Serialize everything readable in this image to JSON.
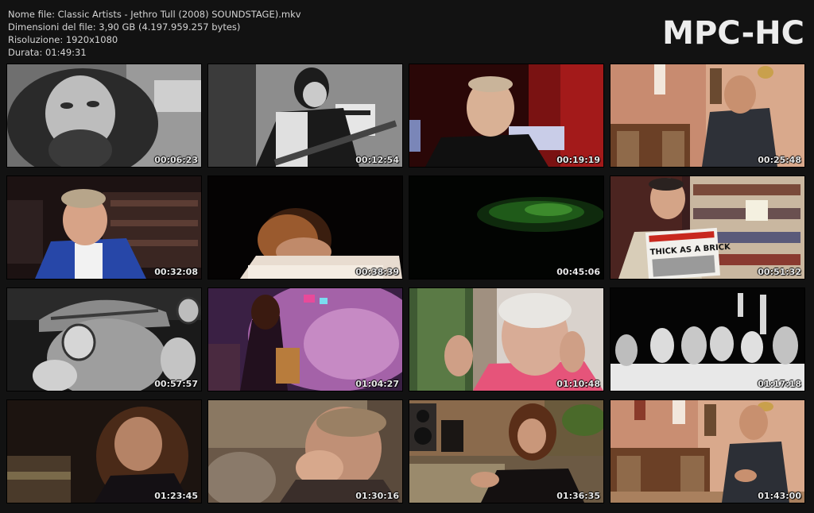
{
  "file_info": {
    "name_line": "Nome file: Classic Artists - Jethro Tull (2008) SOUNDSTAGE).mkv",
    "size_line": "Dimensioni del file: 3,90 GB (4.197.959.257 bytes)",
    "resolution_line": "Risoluzione: 1920x1080",
    "duration_line": "Durata: 01:49:31"
  },
  "brand": "MPC-HC",
  "thumbnails": [
    {
      "time": "00:06:23"
    },
    {
      "time": "00:12:54"
    },
    {
      "time": "00:19:19"
    },
    {
      "time": "00:25:48"
    },
    {
      "time": "00:32:08"
    },
    {
      "time": "00:38:39"
    },
    {
      "time": "00:45:06"
    },
    {
      "time": "00:51:32"
    },
    {
      "time": "00:57:57"
    },
    {
      "time": "01:04:27"
    },
    {
      "time": "01:10:48"
    },
    {
      "time": "01:17:18"
    },
    {
      "time": "01:23:45"
    },
    {
      "time": "01:30:16"
    },
    {
      "time": "01:36:35"
    },
    {
      "time": "01:43:00"
    }
  ],
  "thumb_7_newspaper": "THICK AS A BRICK"
}
